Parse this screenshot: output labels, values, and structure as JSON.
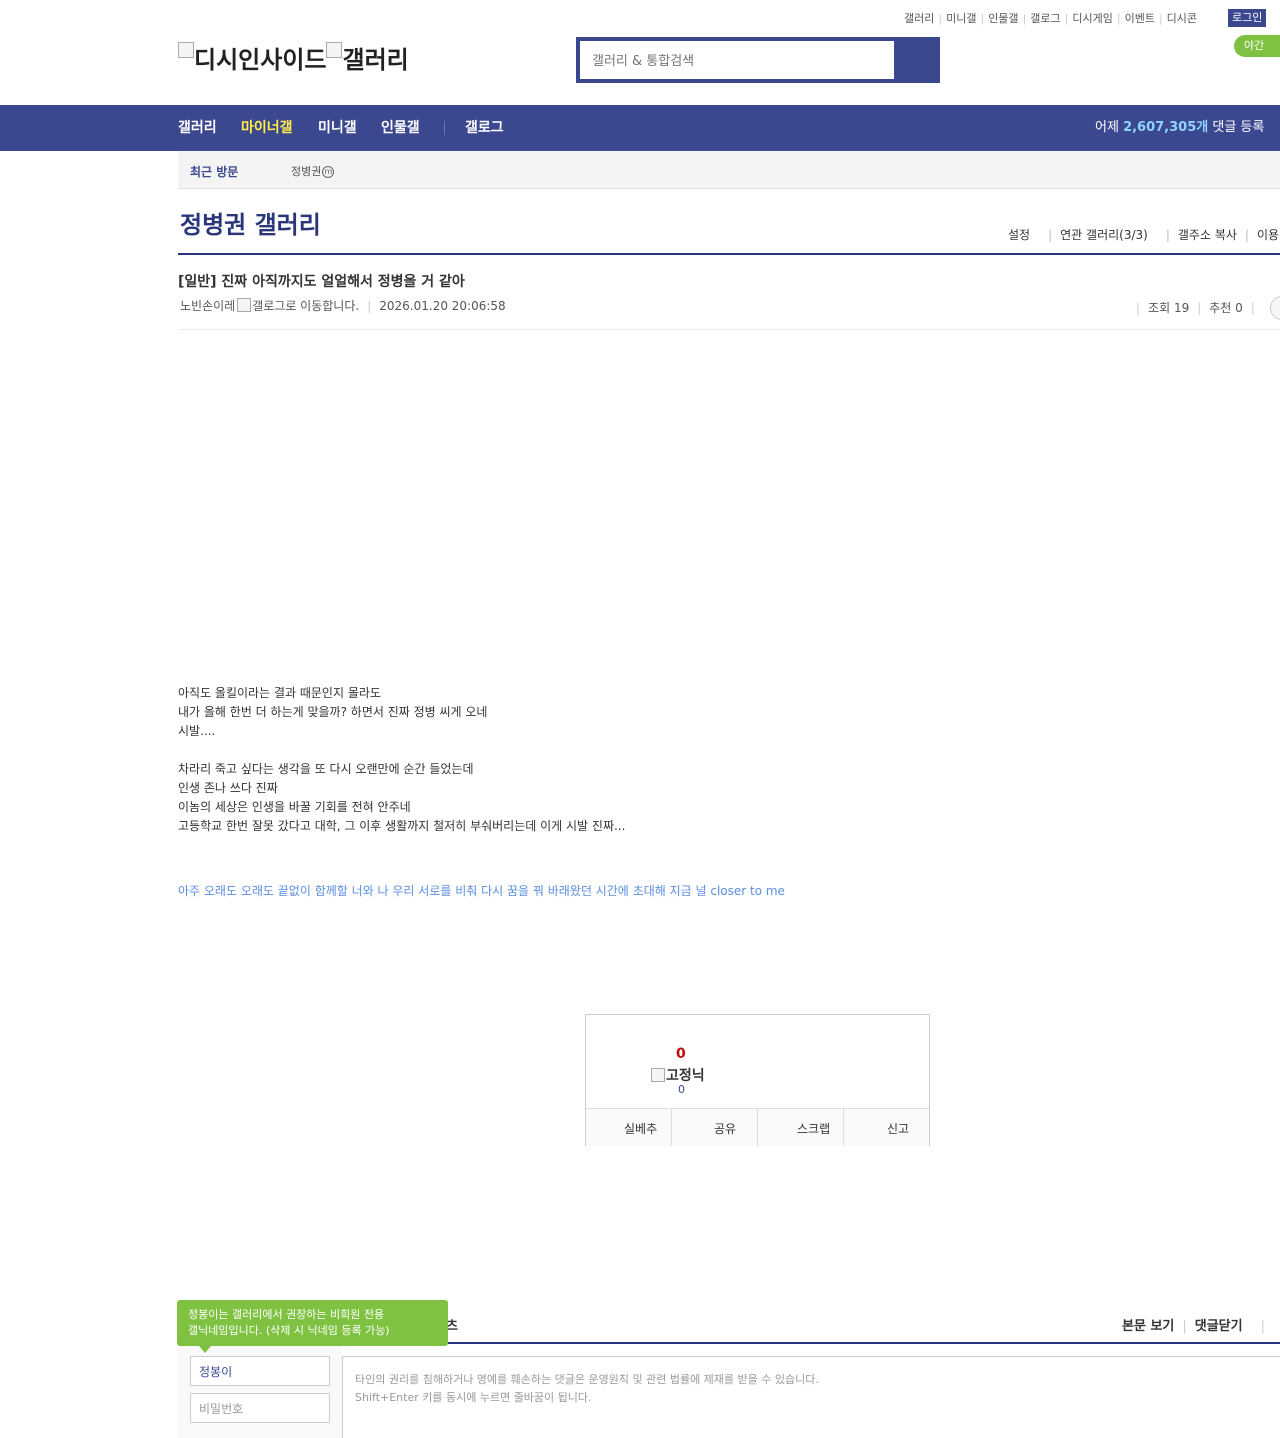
{
  "util_nav": {
    "items": [
      "갤러리",
      "미니갤",
      "인물갤",
      "갤로그",
      "디시게임",
      "이벤트",
      "디시콘"
    ],
    "login": "로그인",
    "night_mode": "야간 모"
  },
  "logo": {
    "part1": "디시인사이드",
    "part2": "갤러리"
  },
  "search": {
    "placeholder": "갤러리 & 통합검색"
  },
  "gnb": {
    "tabs": [
      "갤러리",
      "마이너갤",
      "미니갤",
      "인물갤",
      "갤로그"
    ],
    "active_tab": "마이너갤",
    "stat_prefix": "어제",
    "stat_value": "2,607,305개",
    "stat_suffix": "댓글 등록"
  },
  "recent": {
    "label": "최근 방문",
    "item": "정병권",
    "badge": "m"
  },
  "gallery": {
    "title": "정병권 갤러리",
    "links": [
      "설정",
      "연관 갤러리(3/3)",
      "갤주소 복사",
      "이용"
    ]
  },
  "post": {
    "title": "[일반] 진짜 아직까지도 얼얼해서 정병올 거 같아",
    "author": "노빈손이레",
    "gallog_alt": "갤로그로 이동합니다.",
    "date": "2026.01.20 20:06:58",
    "views_label": "조회 19",
    "recommend_label": "추천 0",
    "body": [
      "아직도 올킬이라는 결과 때문인지 몰라도",
      "내가 올해 한번 더 하는게 맞을까? 하면서 진짜 정병 씨게 오네",
      "시발....",
      "",
      "차라리 죽고 싶다는 생각을 또 다시 오랜만에 순간 들었는데",
      "인생 존나 쓰다 진짜",
      "이놈의 세상은 인생을 바꿀 기회를 전혀 안주네",
      "고등학교 한번 잘못 갔다고 대학, 그 이후 생활까지 철저히 부숴버리는데 이게 시발 진짜..."
    ],
    "lyric": "아주 오래도 오래도 끝없이 함께할 너와 나 우리 서로를 비춰 다시 꿈을 꿔 바래왔던 시간에 초대해 지금 널 closer to me"
  },
  "recommend": {
    "up_count": "0",
    "fixed_nick_alt": "고정닉",
    "down_count": "0",
    "buttons": [
      "실베추",
      "공유",
      "스크랩",
      "신고"
    ]
  },
  "comments": {
    "tooltip_line1": "정봉이는 갤러리에서 권장하는 비회원 전용",
    "tooltip_line2": "갤닉네임입니다. (삭제 시 닉네임 등록 가능)",
    "tail_text": "츠",
    "links": [
      "본문 보기",
      "댓글닫기"
    ],
    "nickname": "정봉이",
    "password_placeholder": "비밀번호",
    "textarea_line1": "타인의 권리를 침해하거나 명예를 훼손하는 댓글은 운영원칙 및 관련 법률에 제재를 받을 수 있습니다.",
    "textarea_line2": "Shift+Enter 키를 동시에 누르면 줄바꿈이 됩니다."
  },
  "colors": {
    "brand": "#3b4890",
    "title_navy": "#29367c",
    "active_yellow": "#ffed45",
    "green": "#7fc241",
    "lyric_blue": "#5b8ee0",
    "recommend_red": "#c20a0a"
  }
}
